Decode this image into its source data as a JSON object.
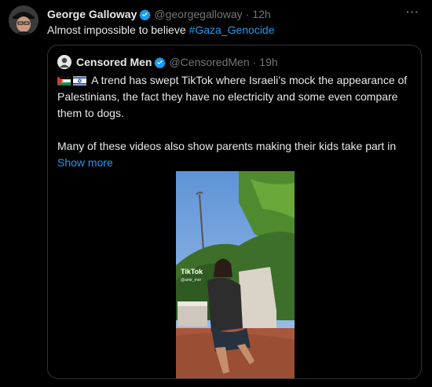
{
  "author": {
    "name": "George Galloway",
    "handle": "@georgegalloway",
    "separator": "·",
    "time": "12h"
  },
  "tweet": {
    "text": "Almost impossible to believe ",
    "hashtag": "#Gaza_Genocide"
  },
  "more_icon": "···",
  "quoted": {
    "name": "Censored Men",
    "handle": "@CensoredMen",
    "separator": "·",
    "time": "19h",
    "flags": [
      "palestine-flag-icon",
      "israel-flag-icon"
    ],
    "paragraph1": "A trend has swept TikTok where Israeli’s mock the appearance of Palestinians, the fact they have no electricity and some even compare them to dogs.",
    "paragraph2": "Many of these videos also show parents making their kids take part in",
    "show_more": "Show more",
    "video_watermark": "TikTok",
    "video_user": "@amir_mor"
  },
  "colors": {
    "background": "#000000",
    "text": "#e7e9ea",
    "muted": "#71767b",
    "accent": "#1d9bf0",
    "border": "#2f3336"
  }
}
